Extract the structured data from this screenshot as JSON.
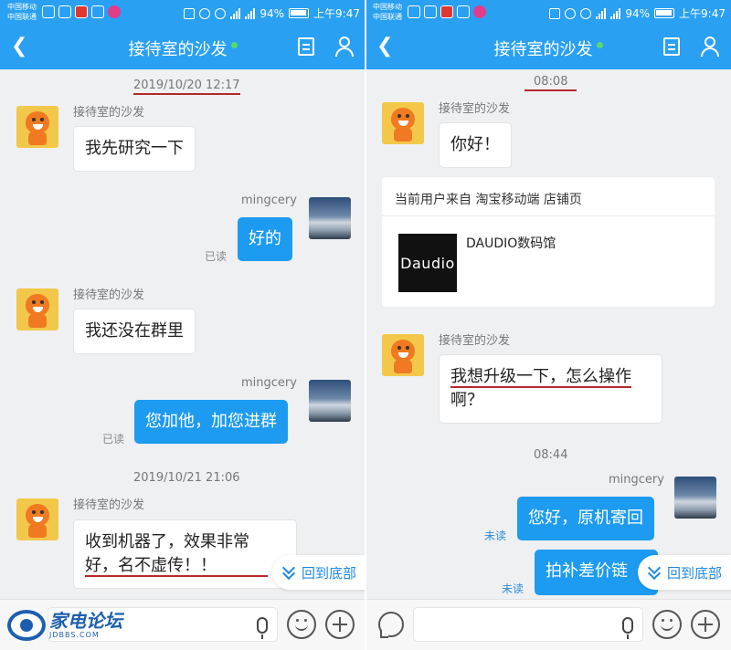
{
  "status_bar": {
    "carrier1": "中国移动",
    "carrier2": "中国联通",
    "network": "4G",
    "battery": "94%",
    "time": "上午9:47"
  },
  "header": {
    "title": "接待室的沙发",
    "online_dot_color": "#59d96b",
    "back_icon": "chevron-left-icon",
    "doc_icon": "document-icon",
    "profile_icon": "user-icon"
  },
  "colors": {
    "brand": "#2aa0f2",
    "out_bubble": "#1d9bf0",
    "annotation_underline": "#b5282b",
    "unread": "#2e8ad8"
  },
  "left": {
    "timestamp1": "2019/10/20 12:17",
    "msg1": {
      "sender": "接待室的沙发",
      "text": "我先研究一下"
    },
    "msg2": {
      "sender": "mingcery",
      "text": "好的",
      "status": "已读"
    },
    "msg3": {
      "sender": "接待室的沙发",
      "text": "我还没在群里"
    },
    "msg4": {
      "sender": "mingcery",
      "text": "您加他，加您进群",
      "status": "已读"
    },
    "timestamp2": "2019/10/21 21:06",
    "msg5": {
      "sender": "接待室的沙发",
      "line1": "收到机器了，效果非常",
      "line2": "好，名不虚传！！"
    },
    "back_to_bottom": "回到底部"
  },
  "right": {
    "timestamp1": "08:08",
    "msg1": {
      "sender": "接待室的沙发",
      "text": "你好！"
    },
    "card": {
      "source": "当前用户来自 淘宝移动端 店铺页",
      "logo_text": "Daudio",
      "shop_name": "DAUDIO数码馆"
    },
    "msg2": {
      "sender": "接待室的沙发",
      "line1": "我想升级一下，怎么操作",
      "line2": "啊？"
    },
    "timestamp2": "08:44",
    "msg3": {
      "sender": "mingcery",
      "text": "您好，原机寄回",
      "status": "未读"
    },
    "msg4": {
      "text": "拍补差价链",
      "status": "未读"
    },
    "back_to_bottom": "回到底部"
  },
  "watermark": {
    "main": "家电论坛",
    "sub": "JDBBS.COM"
  }
}
